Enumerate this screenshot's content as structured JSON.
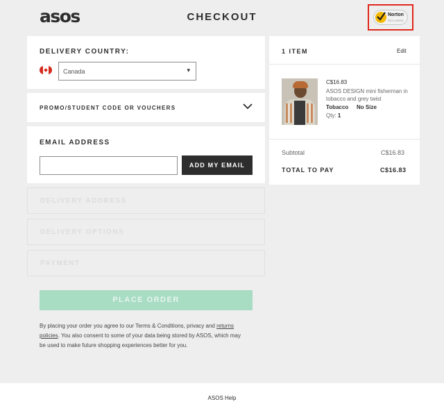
{
  "header": {
    "logo": "asos",
    "title": "CHECKOUT",
    "badge": {
      "name": "Norton",
      "sub": "SECURED"
    }
  },
  "delivery_country": {
    "label": "DELIVERY COUNTRY:",
    "selected": "Canada",
    "flag": "canada-flag"
  },
  "promo": {
    "label": "PROMO/STUDENT CODE OR VOUCHERS"
  },
  "email": {
    "label": "EMAIL ADDRESS",
    "value": "",
    "button": "ADD MY EMAIL"
  },
  "steps": [
    "DELIVERY ADDRESS",
    "DELIVERY OPTIONS",
    "PAYMENT"
  ],
  "place_order": "PLACE ORDER",
  "terms": {
    "part1": "By placing your order you agree to our Terms & Conditions, privacy and ",
    "link": "returns policies",
    "part2": ". You also consent to some of your data being stored by ASOS, which may be used to make future shopping experiences better for you."
  },
  "summary": {
    "item_count": "1 ITEM",
    "edit": "Edit",
    "item": {
      "price": "C$16.83",
      "name": "ASOS DESIGN mini fisherman in tobacco and grey twist",
      "color": "Tobacco",
      "size": "No Size",
      "qty_label": "Qty:",
      "qty": "1"
    },
    "subtotal_label": "Subtotal",
    "subtotal": "C$16.83",
    "total_label": "TOTAL TO PAY",
    "total": "C$16.83"
  },
  "footer": {
    "help": "ASOS Help"
  },
  "colors": {
    "background": "#eeeeee",
    "place_order": "#a8dcc3",
    "norton_highlight": "#e0261b",
    "dark_button": "#2d2d2d"
  }
}
